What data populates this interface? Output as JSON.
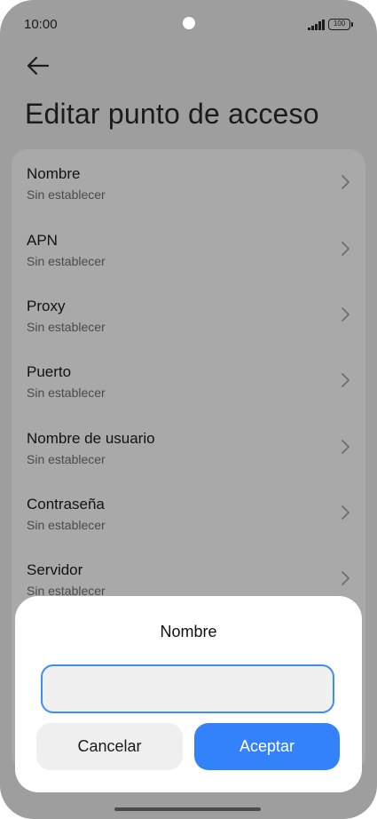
{
  "status_bar": {
    "time": "10:00",
    "battery": "100",
    "icons": [
      "camera-cutout",
      "signal-icon",
      "battery-icon"
    ]
  },
  "header": {
    "back_icon": "arrow-left-icon",
    "title": "Editar punto de acceso"
  },
  "settings": {
    "items": [
      {
        "label": "Nombre",
        "value": "Sin establecer"
      },
      {
        "label": "APN",
        "value": "Sin establecer"
      },
      {
        "label": "Proxy",
        "value": "Sin establecer"
      },
      {
        "label": "Puerto",
        "value": "Sin establecer"
      },
      {
        "label": "Nombre de usuario",
        "value": "Sin establecer"
      },
      {
        "label": "Contraseña",
        "value": "Sin establecer"
      },
      {
        "label": "Servidor",
        "value": "Sin establecer"
      }
    ],
    "chevron_icon": "chevron-right-icon"
  },
  "dialog": {
    "title": "Nombre",
    "input_value": "",
    "cancel_label": "Cancelar",
    "ok_label": "Aceptar"
  },
  "colors": {
    "scrim_background": "#9e9e9e",
    "card_background": "#a9a9a9",
    "accent": "#3482fa",
    "input_border": "#3f8cf3"
  }
}
